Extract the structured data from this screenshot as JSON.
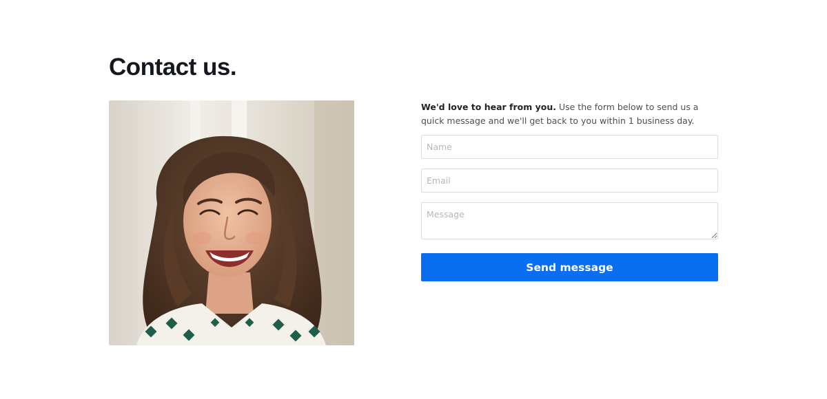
{
  "page": {
    "title": "Contact us."
  },
  "photo": {
    "subject": "smiling-woman-photo"
  },
  "contact_form": {
    "intro_bold": "We'd love to hear from you.",
    "intro_text": " Use the form below to send us a quick message and we'll get back to you within 1 business day.",
    "name_placeholder": "Name",
    "email_placeholder": "Email",
    "message_placeholder": "Message",
    "submit_label": "Send message"
  },
  "colors": {
    "accent": "#0a6ef0",
    "title": "#15191f",
    "border": "#d9dde1"
  }
}
